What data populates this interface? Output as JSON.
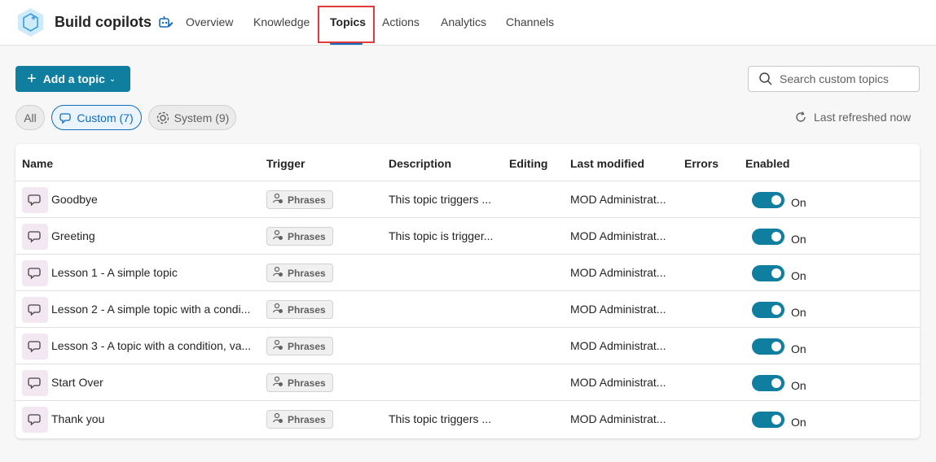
{
  "header": {
    "title": "Build copilots",
    "tabs": [
      {
        "label": "Overview"
      },
      {
        "label": "Knowledge"
      },
      {
        "label": "Topics"
      },
      {
        "label": "Actions"
      },
      {
        "label": "Analytics"
      },
      {
        "label": "Channels"
      }
    ],
    "active_tab": "Topics"
  },
  "toolbar": {
    "add_topic_label": "Add a topic",
    "search_placeholder": "Search custom topics"
  },
  "filters": {
    "all": "All",
    "custom": "Custom (7)",
    "system": "System (9)"
  },
  "refresh_text": "Last refreshed now",
  "table": {
    "columns": [
      "Name",
      "Trigger",
      "Description",
      "Editing",
      "Last modified",
      "Errors",
      "Enabled"
    ],
    "rows": [
      {
        "name": "Goodbye",
        "trigger": "Phrases",
        "description": "This topic triggers ...",
        "modified": "MOD Administrat...",
        "enabled": "On"
      },
      {
        "name": "Greeting",
        "trigger": "Phrases",
        "description": "This topic is trigger...",
        "modified": "MOD Administrat...",
        "enabled": "On"
      },
      {
        "name": "Lesson 1 - A simple topic",
        "trigger": "Phrases",
        "description": "",
        "modified": "MOD Administrat...",
        "enabled": "On"
      },
      {
        "name": "Lesson 2 - A simple topic with a condi...",
        "trigger": "Phrases",
        "description": "",
        "modified": "MOD Administrat...",
        "enabled": "On"
      },
      {
        "name": "Lesson 3 - A topic with a condition, va...",
        "trigger": "Phrases",
        "description": "",
        "modified": "MOD Administrat...",
        "enabled": "On"
      },
      {
        "name": "Start Over",
        "trigger": "Phrases",
        "description": "",
        "modified": "MOD Administrat...",
        "enabled": "On"
      },
      {
        "name": "Thank you",
        "trigger": "Phrases",
        "description": "This topic triggers ...",
        "modified": "MOD Administrat...",
        "enabled": "On"
      }
    ]
  },
  "colors": {
    "accent": "#0f7e9f",
    "highlight": "#e0393e",
    "topic_icon_bg": "#f3e8f1"
  }
}
